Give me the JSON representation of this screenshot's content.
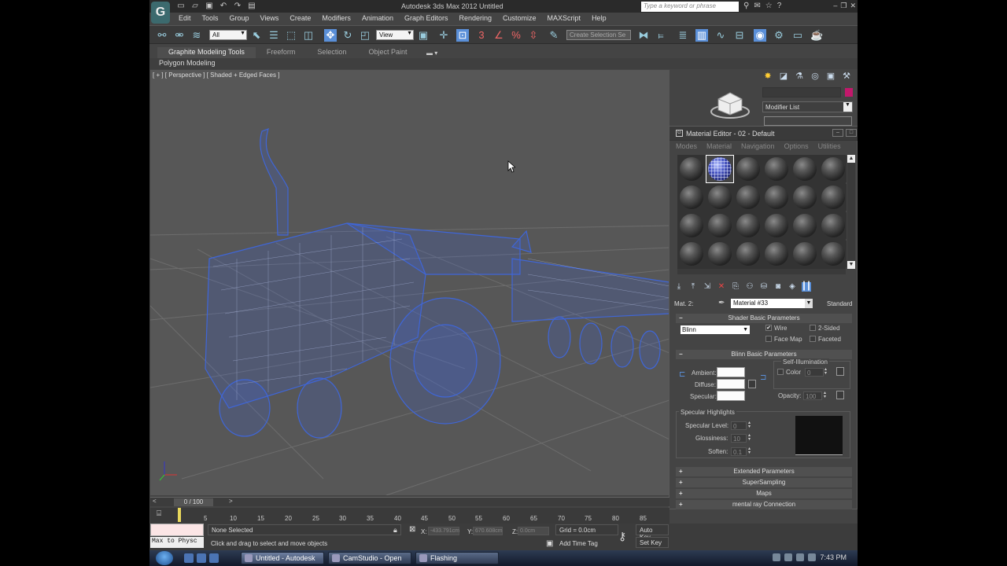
{
  "app": {
    "title": "Autodesk 3ds Max  2012     Untitled",
    "search_placeholder": "Type a keyword or phrase",
    "menu": [
      "Edit",
      "Tools",
      "Group",
      "Views",
      "Create",
      "Modifiers",
      "Animation",
      "Graph Editors",
      "Rendering",
      "Customize",
      "MAXScript",
      "Help"
    ]
  },
  "toolbar": {
    "selection_filter": "All",
    "ref_coord": "View",
    "named_selection": "Create Selection Se"
  },
  "ribbon": {
    "tabs": [
      "Graphite Modeling Tools",
      "Freeform",
      "Selection",
      "Object Paint"
    ],
    "active_tab": "Graphite Modeling Tools",
    "panel": "Polygon Modeling"
  },
  "viewport": {
    "label": "[ + ] [ Perspective ] [ Shaded + Edged Faces ]"
  },
  "command_panel": {
    "modifier_list": "Modifier List"
  },
  "material_editor": {
    "title": "Material Editor - 02 - Default",
    "menu": [
      "Modes",
      "Material",
      "Navigation",
      "Options",
      "Utilities"
    ],
    "mat_label": "Mat. 2:",
    "mat_name": "Material #33",
    "mat_type": "Standard",
    "shader_rollout": "Shader Basic Parameters",
    "shader": "Blinn",
    "wire": "Wire",
    "two_sided": "2-Sided",
    "face_map": "Face Map",
    "faceted": "Faceted",
    "blinn_rollout": "Blinn Basic Parameters",
    "self_illum": "Self-Illumination",
    "color_label": "Color",
    "color_value": "0",
    "ambient": "Ambient:",
    "diffuse": "Diffuse:",
    "specular": "Specular:",
    "opacity_label": "Opacity:",
    "opacity_value": "100",
    "spec_highlights": "Specular Highlights",
    "spec_level_label": "Specular Level:",
    "spec_level": "0",
    "glossiness_label": "Glossiness:",
    "glossiness": "10",
    "soften_label": "Soften:",
    "soften": "0.1",
    "rollouts": [
      "Extended Parameters",
      "SuperSampling",
      "Maps",
      "mental ray Connection"
    ]
  },
  "timeline": {
    "frame": "0 / 100",
    "ticks": [
      "5",
      "10",
      "15",
      "20",
      "25",
      "30",
      "35",
      "40",
      "45",
      "50",
      "55",
      "60",
      "65",
      "70",
      "75",
      "80",
      "85"
    ]
  },
  "status": {
    "maxscript": "Max to Physc",
    "selection": "None Selected",
    "prompt": "Click and drag to select and move objects",
    "x_label": "X:",
    "x_value": "-433.791cm",
    "y_label": "Y:",
    "y_value": "670.608cm",
    "z_label": "Z:",
    "z_value": "0.0cm",
    "grid": "Grid = 0.0cm",
    "add_time_tag": "Add Time Tag",
    "auto_key": "Auto Key",
    "set_key": "Set Key"
  },
  "taskbar": {
    "items": [
      "Untitled - Autodesk ...",
      "CamStudio - Open ...",
      "Flashing"
    ],
    "clock": "7:43 PM"
  },
  "colors": {
    "wire_blue": "#3f66d8",
    "viewport_bg": "#575757",
    "object_color": "#c2186b"
  }
}
